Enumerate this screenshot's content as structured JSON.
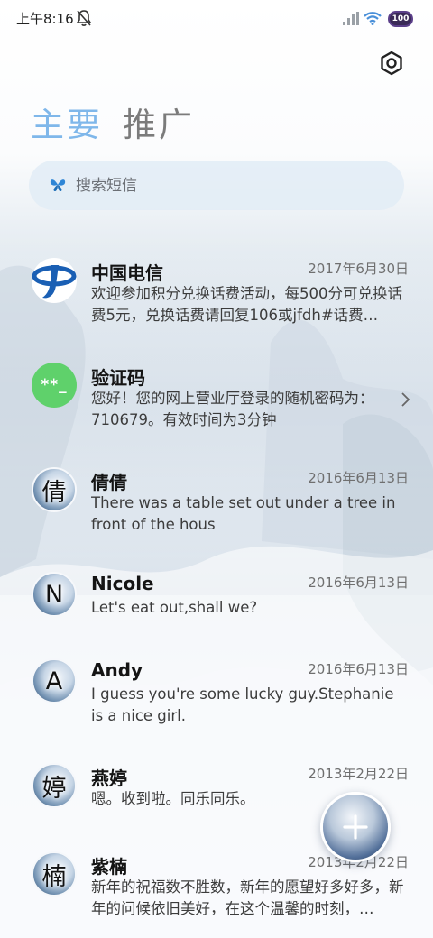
{
  "status_bar": {
    "time": "上午8:16",
    "battery_label": "100"
  },
  "tabs": [
    {
      "label": "主要",
      "active": true
    },
    {
      "label": "推广",
      "active": false
    }
  ],
  "search": {
    "placeholder": "搜索短信"
  },
  "conversations": [
    {
      "sender": "中国电信",
      "date": "2017年6月30日",
      "preview": "欢迎参加积分兑换话费活动，每500分可兑换话费5元，兑换话费请回复106或jfdh#话费…",
      "avatar": "telecom-logo"
    },
    {
      "sender": "验证码",
      "date": "",
      "preview": "您好！您的网上营业厅登录的随机密码为：710679。有效时间为3分钟",
      "avatar_text": "**_"
    },
    {
      "sender": "倩倩",
      "date": "2016年6月13日",
      "preview": "There was a table set out under a tree in front of the hous",
      "avatar_text": "倩"
    },
    {
      "sender": "Nicole",
      "date": "2016年6月13日",
      "preview": "Let's eat out,shall we?",
      "avatar_text": "N"
    },
    {
      "sender": "Andy",
      "date": "2016年6月13日",
      "preview": "I guess you're some lucky guy.Stephanie is a nice girl.",
      "avatar_text": "A"
    },
    {
      "sender": "燕婷",
      "date": "2013年2月22日",
      "preview": "嗯。收到啦。同乐同乐。",
      "avatar_text": "婷"
    },
    {
      "sender": "紫楠",
      "date": "2013年2月22日",
      "preview": "新年的祝福数不胜数，新年的愿望好多好多，新年的问候依旧美好，在这个温馨的时刻，…",
      "avatar_text": "楠"
    }
  ],
  "colors": {
    "accent_tab": "#7fb7ea",
    "code_avatar": "#5fd16b",
    "telecom_blue": "#1a5fb4"
  },
  "icons": [
    "mute-icon",
    "signal-icon",
    "wifi-icon",
    "battery-icon",
    "settings-icon",
    "search-icon",
    "chevron-right-icon",
    "plus-icon"
  ]
}
